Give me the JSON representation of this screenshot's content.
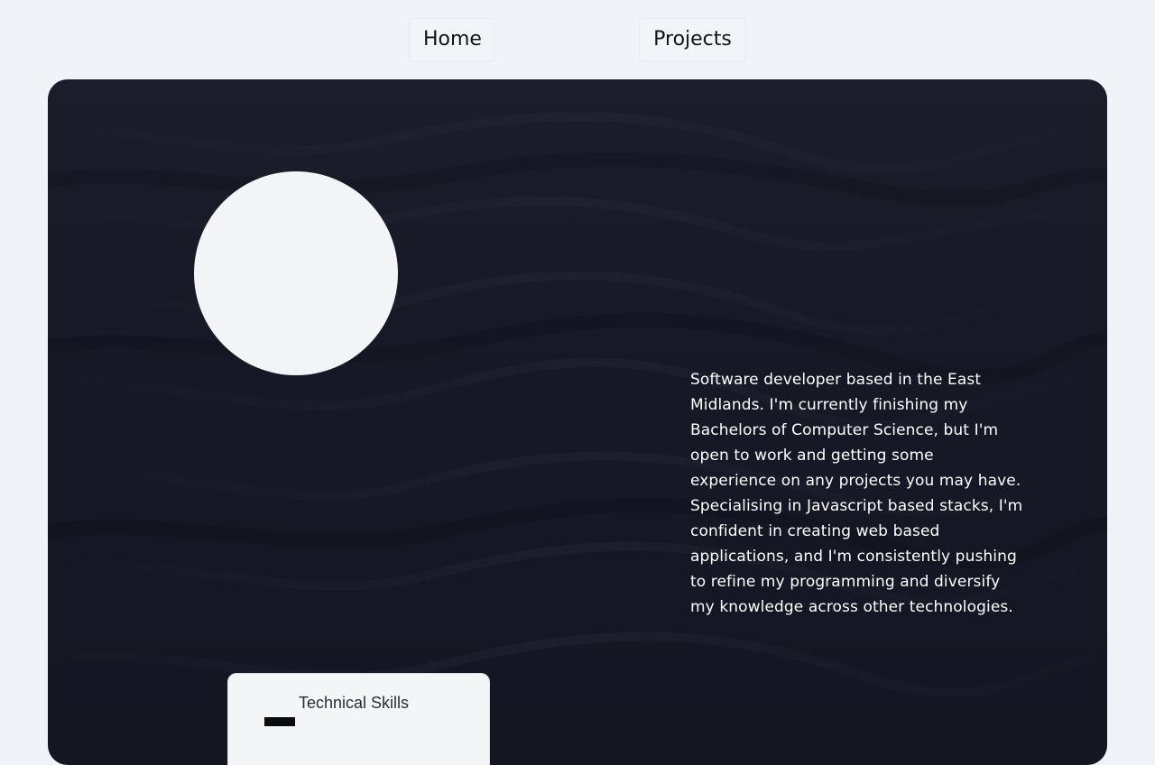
{
  "nav": {
    "home_label": "Home",
    "projects_label": "Projects"
  },
  "hero": {
    "bio": "Software developer based in the East Midlands. I'm currently finishing my Bachelors of Computer Science, but I'm open to work and getting some experience on any projects you may have. Specialising in Javascript based stacks, I'm confident in creating web based applications, and I'm consistently pushing to refine my programming and diversify my knowledge across other technologies."
  },
  "skills_card": {
    "title": "Technical Skills"
  },
  "colors": {
    "page_background": "#f0f4f8",
    "hero_background": "#161826",
    "avatar_fill": "#f2f4f7",
    "text_light": "#ffffff",
    "card_background": "#f4f5f7"
  }
}
